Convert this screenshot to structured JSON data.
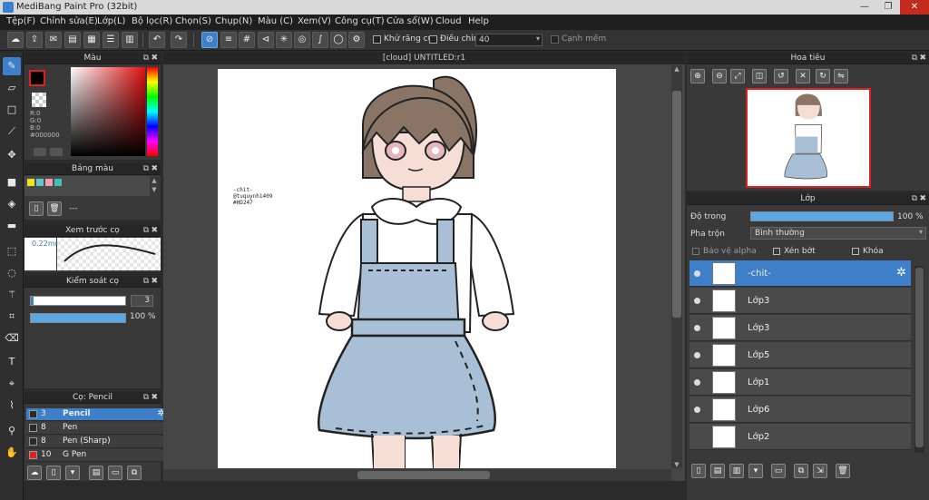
{
  "window": {
    "title": "MediBang Paint Pro (32bit)",
    "min": "—",
    "max": "❐",
    "close": "✕"
  },
  "menu": [
    "Tệp(F)",
    "Chỉnh sửa(E)",
    "Lớp(L)",
    "Bộ lọc(R)",
    "Chọn(S)",
    "Chụp(N)",
    "Màu (C)",
    "Xem(V)",
    "Công cụ(T)",
    "Cửa sổ(W)",
    "Cloud",
    "Help"
  ],
  "toolbar": {
    "antialias_label": "Khử răng cưa",
    "adjust_label": "Điều chỉnh",
    "adjust_value": "40",
    "edge_label": "Cạnh mềm"
  },
  "color_panel": {
    "title": "Màu",
    "r": "R:0",
    "g": "G:0",
    "b": "B:0",
    "hex": "#000000"
  },
  "swatch_panel": {
    "title": "Bảng màu",
    "name": "---",
    "swatches": [
      "#f0e020",
      "#60c8c8",
      "#f0a0b0",
      "#40c0b0"
    ]
  },
  "brush_preview": {
    "title": "Xem trước cọ",
    "size": "0.22mm"
  },
  "brush_control": {
    "title": "Kiểm soát cọ",
    "size": "3",
    "opacity": "100 %",
    "opacity_value": 100
  },
  "brush_list": {
    "title": "Cọ: Pencil",
    "items": [
      {
        "size": "3",
        "name": "Pencil",
        "color": "#2a2a2a",
        "active": true
      },
      {
        "size": "8",
        "name": "Pen",
        "color": "#2a2a2a",
        "active": false
      },
      {
        "size": "8",
        "name": "Pen (Sharp)",
        "color": "#2a2a2a",
        "active": false
      },
      {
        "size": "10",
        "name": "G Pen",
        "color": "#e02020",
        "active": false
      }
    ]
  },
  "document": {
    "tab": "[cloud] UNTITLED:r1",
    "signature": [
      "-chit-",
      "@tuquynh1409",
      "#HD247"
    ]
  },
  "navigator": {
    "title": "Hoa tiêu"
  },
  "layers": {
    "title": "Lớp",
    "opacity_label": "Độ trong",
    "opacity": "100 %",
    "opacity_value": 100,
    "blend_label": "Pha trộn",
    "blend_value": "Bình thường",
    "protect_alpha": "Bảo vệ alpha",
    "clipping": "Xén bớt",
    "lock": "Khóa",
    "items": [
      {
        "name": "-chit-",
        "active": true
      },
      {
        "name": "Lớp3",
        "active": false
      },
      {
        "name": "Lớp3",
        "active": false
      },
      {
        "name": "Lớp5",
        "active": false
      },
      {
        "name": "Lớp1",
        "active": false
      },
      {
        "name": "Lớp6",
        "active": false
      },
      {
        "name": "Lớp2",
        "active": false
      }
    ]
  },
  "colors": {
    "accent": "#3d7fc9",
    "skirt": "#a9bfd6",
    "hair": "#8a7466"
  }
}
